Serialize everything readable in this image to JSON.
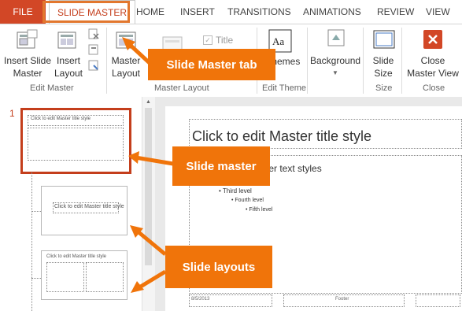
{
  "tabs": [
    "FILE",
    "SLIDE MASTER",
    "HOME",
    "INSERT",
    "TRANSITIONS",
    "ANIMATIONS",
    "REVIEW",
    "VIEW"
  ],
  "ribbon": {
    "insert_slide_master": [
      "Insert Slide",
      "Master"
    ],
    "insert_layout": [
      "Insert",
      "Layout"
    ],
    "master_layout": [
      "Master",
      "Layout"
    ],
    "title_checkbox": "Title",
    "themes": "Themes",
    "background": "Background",
    "slide_size": [
      "Slide",
      "Size"
    ],
    "close_master_view": [
      "Close",
      "Master View"
    ],
    "groups": [
      "Edit Master",
      "Master Layout",
      "Edit Theme",
      "Size",
      "Close"
    ]
  },
  "thumbnails": {
    "number": "1",
    "master_title": "Click to edit Master title style",
    "layout1_title": "Click to edit Master title style",
    "layout2_title": "Click to edit Master title style"
  },
  "slide": {
    "title": "Click to edit Master title style",
    "body_partial": "ter text styles",
    "levels": [
      "Third level",
      "Fourth level",
      "Fifth level"
    ],
    "date": "8/5/2013",
    "footer": "Footer"
  },
  "callouts": {
    "slide_master_tab": "Slide Master tab",
    "slide_master": "Slide master",
    "slide_layouts": "Slide layouts"
  },
  "colors": {
    "accent": "#d24726",
    "callout": "#f0740a",
    "close_red": "#d24726"
  }
}
